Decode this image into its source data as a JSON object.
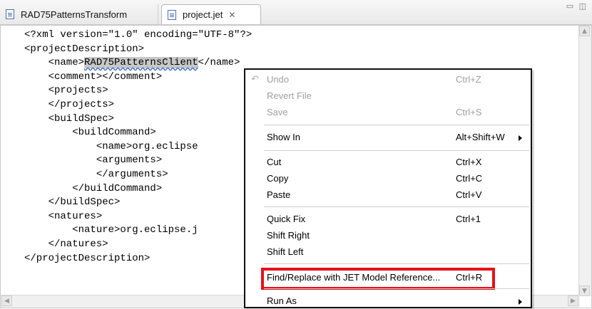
{
  "tabs": [
    {
      "label": "RAD75PatternsTransform",
      "active": false
    },
    {
      "label": "project.jet",
      "active": true,
      "close_glyph": "✕"
    }
  ],
  "view_controls": "▭ ◫",
  "editor": {
    "lines": [
      "<?xml version=\"1.0\" encoding=\"UTF-8\"?>",
      "<projectDescription>",
      "    <name>RAD75PatternsClient</name>",
      "    <comment></comment>",
      "    <projects>",
      "    </projects>",
      "    <buildSpec>",
      "        <buildCommand>",
      "            <name>org.eclipse",
      "            <arguments>",
      "            </arguments>",
      "        </buildCommand>",
      "    </buildSpec>",
      "    <natures>",
      "        <nature>org.eclipse.j",
      "    </natures>",
      "</projectDescription>"
    ],
    "selected_text": "RAD75PatternsClient",
    "selected_line_prefix": "    <name>",
    "selected_line_suffix": "</name>"
  },
  "context_menu": {
    "items": [
      {
        "label": "Undo",
        "shortcut": "Ctrl+Z",
        "disabled": true,
        "icon": "undo-icon"
      },
      {
        "label": "Revert File",
        "shortcut": "",
        "disabled": true
      },
      {
        "label": "Save",
        "shortcut": "Ctrl+S",
        "disabled": true
      },
      {
        "label": "Show In",
        "shortcut": "Alt+Shift+W",
        "submenu": true
      },
      {
        "label": "Cut",
        "shortcut": "Ctrl+X"
      },
      {
        "label": "Copy",
        "shortcut": "Ctrl+C"
      },
      {
        "label": "Paste",
        "shortcut": "Ctrl+V"
      },
      {
        "label": "Quick Fix",
        "shortcut": "Ctrl+1"
      },
      {
        "label": "Shift Right",
        "shortcut": ""
      },
      {
        "label": "Shift Left",
        "shortcut": ""
      },
      {
        "label": "Find/Replace with JET Model Reference...",
        "shortcut": "Ctrl+R",
        "highlighted": true
      },
      {
        "label": "Run As",
        "shortcut": "",
        "submenu": true
      }
    ]
  },
  "colors": {
    "highlight_border": "#e8101a",
    "selection_bg": "#c7c7c7",
    "disabled_text": "#a0a0a0"
  }
}
